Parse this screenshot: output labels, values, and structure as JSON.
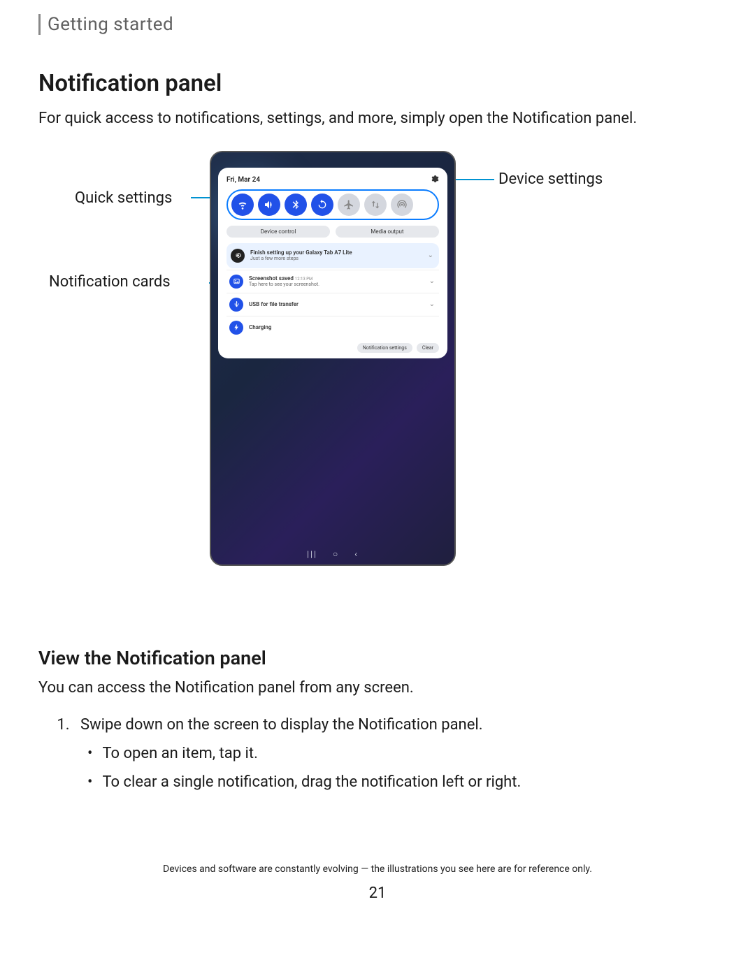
{
  "breadcrumb": "Getting started",
  "h1": "Notification panel",
  "intro": "For quick access to notifications, settings, and more, simply open the Notification panel.",
  "callouts": {
    "quick_settings": "Quick settings",
    "notification_cards": "Notification cards",
    "device_settings": "Device settings"
  },
  "device": {
    "date": "Fri, Mar 24",
    "pills": {
      "device_control": "Device control",
      "media_output": "Media output"
    },
    "cards": {
      "setup": {
        "title": "Finish setting up your Galaxy Tab A7 Lite",
        "sub": "Just a few more steps"
      },
      "screenshot": {
        "title": "Screenshot saved",
        "time": "12:13 PM",
        "sub": "Tap here to see your screenshot."
      },
      "usb": {
        "title": "USB for file transfer"
      },
      "charging": {
        "title": "Charging"
      }
    },
    "buttons": {
      "settings": "Notification settings",
      "clear": "Clear"
    }
  },
  "h2": "View the Notification panel",
  "p2": "You can access the Notification panel from any screen.",
  "step1": "Swipe down on the screen to display the Notification panel.",
  "bullet1": "To open an item, tap it.",
  "bullet2": "To clear a single notification, drag the notification left or right.",
  "footnote": "Devices and software are constantly evolving — the illustrations you see here are for reference only.",
  "page_number": "21"
}
